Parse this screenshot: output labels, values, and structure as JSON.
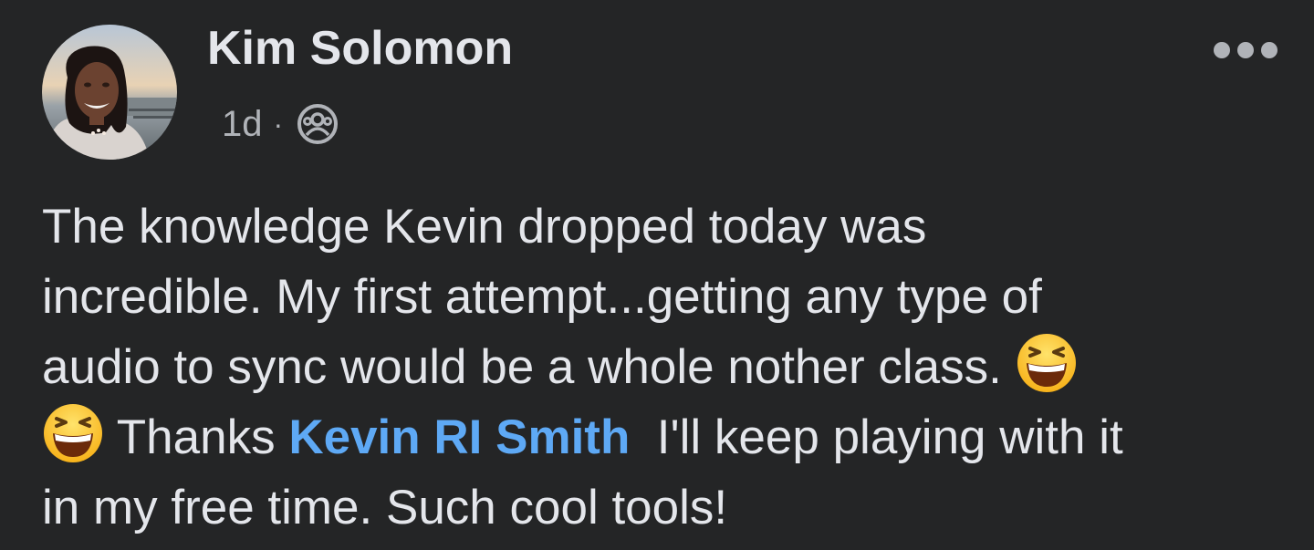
{
  "post": {
    "author_name": "Kim Solomon",
    "timestamp": "1d",
    "separator": "·",
    "audience_icon": "friends-icon",
    "more_icon": "more-options-icon",
    "text": {
      "line1": "The knowledge Kevin dropped today was",
      "line2": "incredible. My first attempt...getting any type of",
      "line3": "audio to sync would be a whole nother class.",
      "line4_before": "Thanks",
      "mention": "Kevin RI Smith",
      "line4_after": "I'll keep playing with it",
      "line5": "in my free time. Such cool tools!"
    },
    "emoji": "grinning-squinting-face",
    "colors": {
      "background": "#242526",
      "primary_text": "#e4e6eb",
      "secondary_text": "#b0b3b8",
      "mention": "#5ea9f5"
    }
  }
}
